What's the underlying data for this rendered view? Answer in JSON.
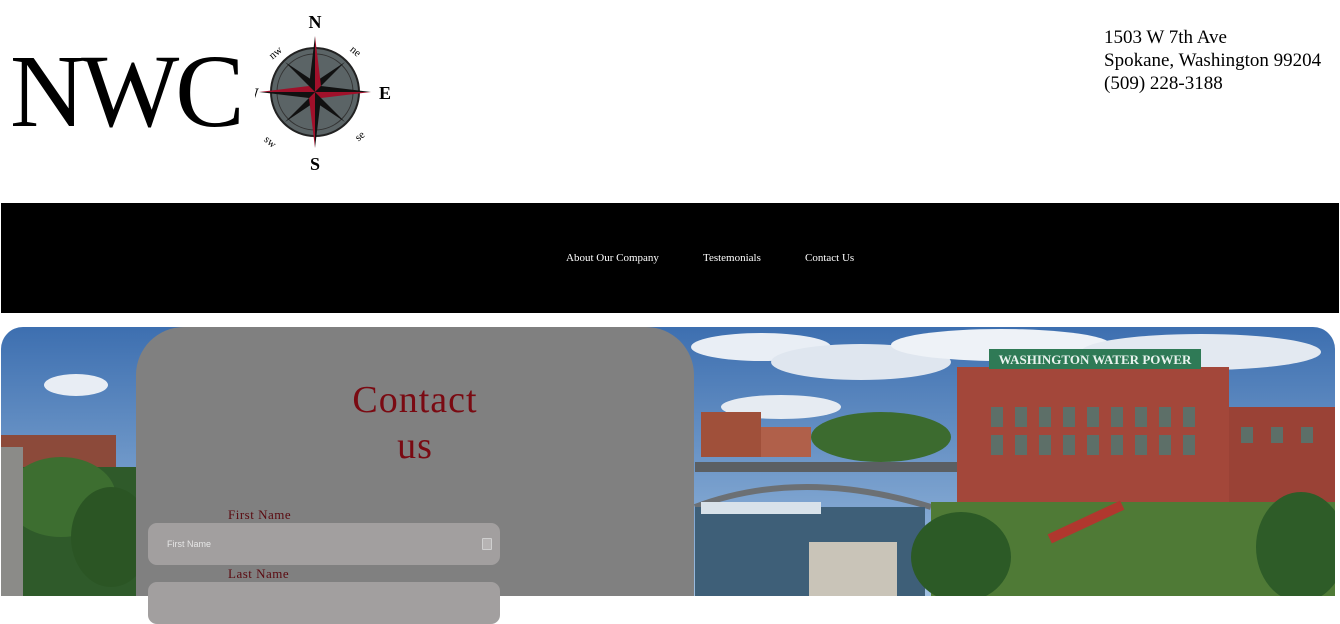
{
  "header": {
    "logo_text": "NWC",
    "compass": {
      "n": "N",
      "s": "S",
      "e": "E",
      "w": "W",
      "ne": "ne",
      "nw": "nw",
      "se": "se",
      "sw": "sw"
    },
    "address_line1": "1503 W 7th Ave",
    "address_line2": "Spokane, Washington 99204",
    "phone": "(509) 228-3188"
  },
  "nav": {
    "items": [
      {
        "label": "About Our Company"
      },
      {
        "label": "Testemonials"
      },
      {
        "label": "Contact Us"
      }
    ]
  },
  "hero": {
    "building_sign": "WASHINGTON WATER POWER"
  },
  "form": {
    "title_line1": "Contact",
    "title_line2": "us",
    "first_name_label": "First Name",
    "first_name_placeholder": "First Name",
    "last_name_label": "Last Name"
  },
  "colors": {
    "nav_bg": "#000000",
    "panel_bg": "#808080",
    "title_color": "#7a0a12",
    "compass_red": "#a0102a"
  }
}
